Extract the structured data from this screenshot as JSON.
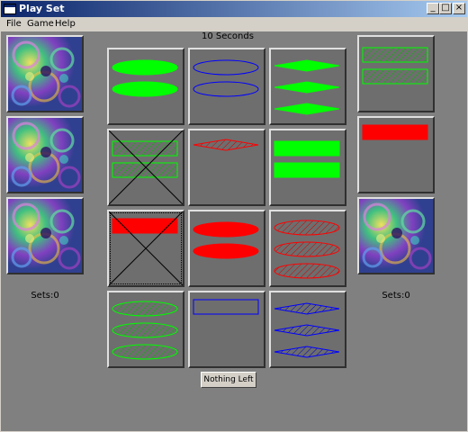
{
  "window": {
    "title": "Play Set"
  },
  "titlebar_buttons": {
    "minimize": "_",
    "maximize": "□",
    "close": "×"
  },
  "menu": {
    "items": [
      "File",
      "Game",
      "Help"
    ]
  },
  "timer": {
    "text": "10 Seconds"
  },
  "left_player": {
    "sets_label": "Sets:0"
  },
  "right_player": {
    "sets_label": "Sets:0"
  },
  "nothing_left_button": {
    "label": "Nothing Left"
  },
  "colors": {
    "green": "#00ff00",
    "red": "#ff0000",
    "blue": "#0000ff",
    "card_bg": "#6e6e6e"
  },
  "cards": [
    {
      "count": 2,
      "shape": "oval",
      "fill": "solid",
      "color": "green",
      "crossed": false
    },
    {
      "count": 2,
      "shape": "oval",
      "fill": "open",
      "color": "blue",
      "crossed": false
    },
    {
      "count": 3,
      "shape": "diamond",
      "fill": "solid",
      "color": "green",
      "crossed": false
    },
    {
      "count": 2,
      "shape": "rect",
      "fill": "striped",
      "color": "green",
      "crossed": true
    },
    {
      "count": 1,
      "shape": "diamond",
      "fill": "striped",
      "color": "red",
      "crossed": false
    },
    {
      "count": 2,
      "shape": "rect",
      "fill": "solid",
      "color": "green",
      "crossed": false
    },
    {
      "count": 1,
      "shape": "rect",
      "fill": "solid",
      "color": "red",
      "crossed": true,
      "selected": true
    },
    {
      "count": 2,
      "shape": "oval",
      "fill": "solid",
      "color": "red",
      "crossed": false
    },
    {
      "count": 3,
      "shape": "oval",
      "fill": "striped",
      "color": "red",
      "crossed": false
    },
    {
      "count": 3,
      "shape": "oval",
      "fill": "striped",
      "color": "green",
      "crossed": false
    },
    {
      "count": 1,
      "shape": "rect",
      "fill": "open",
      "color": "blue",
      "crossed": false
    },
    {
      "count": 3,
      "shape": "diamond",
      "fill": "striped",
      "color": "blue",
      "crossed": false
    }
  ],
  "side_cards": [
    {
      "count": 2,
      "shape": "rect",
      "fill": "striped",
      "color": "green"
    },
    {
      "count": 1,
      "shape": "rect",
      "fill": "solid",
      "color": "red"
    }
  ]
}
